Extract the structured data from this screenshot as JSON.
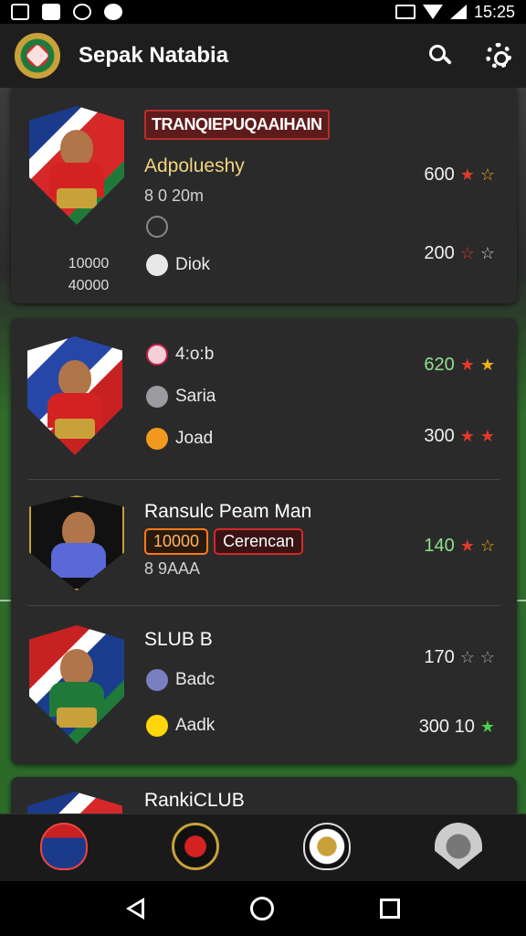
{
  "status_bar": {
    "time": "15:25"
  },
  "app_bar": {
    "title": "Sepak Natabia"
  },
  "cards": [
    {
      "banner": "TRANQIEPUQAAIHAIN",
      "name": "Adpolueshy",
      "sub": "8 0 20m",
      "player_meta_line1": "10000",
      "player_meta_line2": "40000",
      "item_label": "Diok",
      "score_top": "600",
      "score_bottom": "200"
    },
    {
      "rows": [
        {
          "items": [
            "4:o:b",
            "Saria",
            "Joad"
          ],
          "score_top": "620",
          "score_bottom": "300"
        },
        {
          "name": "Ransulc Peam Man",
          "tag_1": "10000",
          "tag_2": "Cerencan",
          "sub": "8 9AAA",
          "score": "140"
        },
        {
          "name": "SLUB B",
          "items": [
            "Badc",
            "Aadk"
          ],
          "score_top": "170",
          "score_bottom": "300 10"
        }
      ]
    },
    {
      "name": "RankiCLUB"
    }
  ],
  "colors": {
    "accent": "#d02a2a",
    "pitch": "#2c6a2a",
    "card": "#2a2a2a"
  }
}
